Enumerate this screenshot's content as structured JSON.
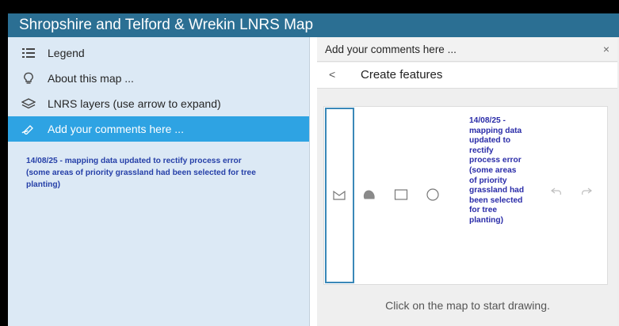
{
  "app": {
    "title": "Shropshire and Telford & Wrekin LNRS Map"
  },
  "sidebar": {
    "items": [
      {
        "label": "Legend",
        "icon": "legend-list-icon"
      },
      {
        "label": "About this map ...",
        "icon": "lightbulb-icon"
      },
      {
        "label": "LNRS layers (use arrow to expand)",
        "icon": "layers-icon"
      },
      {
        "label": "Add your comments here ...",
        "icon": "edit-comment-icon",
        "active": true
      }
    ],
    "notice": "14/08/25 - mapping data updated to rectify process error (some areas of priority grassland had been selected for tree planting)"
  },
  "panel": {
    "header": "Add your comments here ...",
    "close": "×",
    "back": "<",
    "subtitle": "Create features",
    "tool_notice": "14/08/25 - mapping data updated to rectify process error (some areas of priority grassland had been selected for tree planting)",
    "hint": "Click on the map to start drawing."
  },
  "colors": {
    "titlebar": "#2b6f93",
    "sidebar": "#dce9f5",
    "active": "#2ea3e3",
    "notice": "#2640a8"
  }
}
